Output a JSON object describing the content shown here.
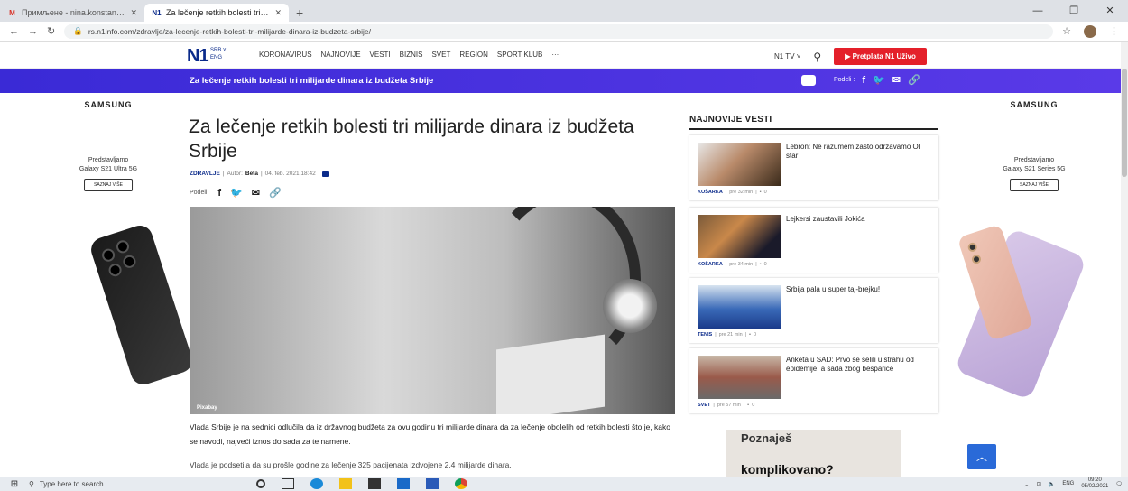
{
  "browser": {
    "tabs": [
      {
        "favicon": "M",
        "title": "Примљене - nina.konstantinidi",
        "active": false
      },
      {
        "favicon": "N1",
        "title": "Za lečenje retkih bolesti tri milija",
        "active": true
      }
    ],
    "url": "rs.n1info.com/zdravlje/za-lecenje-retkih-bolesti-tri-milijarde-dinara-iz-budzeta-srbije/"
  },
  "site": {
    "logo": "N1",
    "lang_primary": "SRB ˅",
    "lang_secondary": "ENG",
    "menu": [
      "KORONAVIRUS",
      "NAJNOVIJE",
      "VESTI",
      "BIZNIS",
      "SVET",
      "REGION",
      "SPORT KLUB",
      "···"
    ],
    "tv_label": "N1 TV ˅",
    "subscribe_label": "▶ Pretplata N1 Uživo"
  },
  "bluebar": {
    "headline": "Za lečenje retkih bolesti tri milijarde dinara iz budžeta Srbije",
    "share_label": "Podeli :"
  },
  "ads": {
    "brand": "SAMSUNG",
    "left_text": "Predstavljamo\nGalaxy S21 Ultra 5G",
    "right_text": "Predstavljamo\nGalaxy S21 Series 5G",
    "cta": "SAZNAJ VIŠE"
  },
  "article": {
    "title": "Za lečenje retkih bolesti tri milijarde dinara iz budžeta Srbije",
    "category": "ZDRAVLJE",
    "author_prefix": "Autor:",
    "author": "Beta",
    "date": "04. feb. 2021 18:42",
    "share_label": "Podeli:",
    "photo_credit": "Pixabay",
    "paragraph1": "Vlada Srbije je na sednici odlučila da iz državnog budžeta za ovu godinu tri milijarde dinara da za lečenje obolelih od retkih bolesti što je, kako se navodi, najveći iznos do sada za te namene.",
    "paragraph2": "Vlada je podsetila da su prošle godine za lečenje 325 pacijenata izdvojene 2,4 milijarde dinara."
  },
  "sidebar": {
    "title": "NAJNOVIJE VESTI",
    "items": [
      {
        "headline": "Lebron: Ne razumem zašto održavamo Ol star",
        "category": "KOŠARKA",
        "time": "pre 32 min",
        "comments": "0"
      },
      {
        "headline": "Lejkersi zaustavili Jokića",
        "category": "KOŠARKA",
        "time": "pre 34 min",
        "comments": "0"
      },
      {
        "headline": "Srbija pala u super taj-brejku!",
        "category": "TENIS",
        "time": "pre 21 min",
        "comments": "0"
      },
      {
        "headline": "Anketa u SAD: Prvo se selili u strahu od epidemije, a sada zbog besparice",
        "category": "SVET",
        "time": "pre 57 min",
        "comments": "0"
      }
    ],
    "promo_line1": "Poznaješ",
    "promo_line2": "komplikovano?"
  },
  "taskbar": {
    "search_placeholder": "Type here to search",
    "lang": "ENG",
    "time": "09:20",
    "date": "05/02/2021"
  }
}
